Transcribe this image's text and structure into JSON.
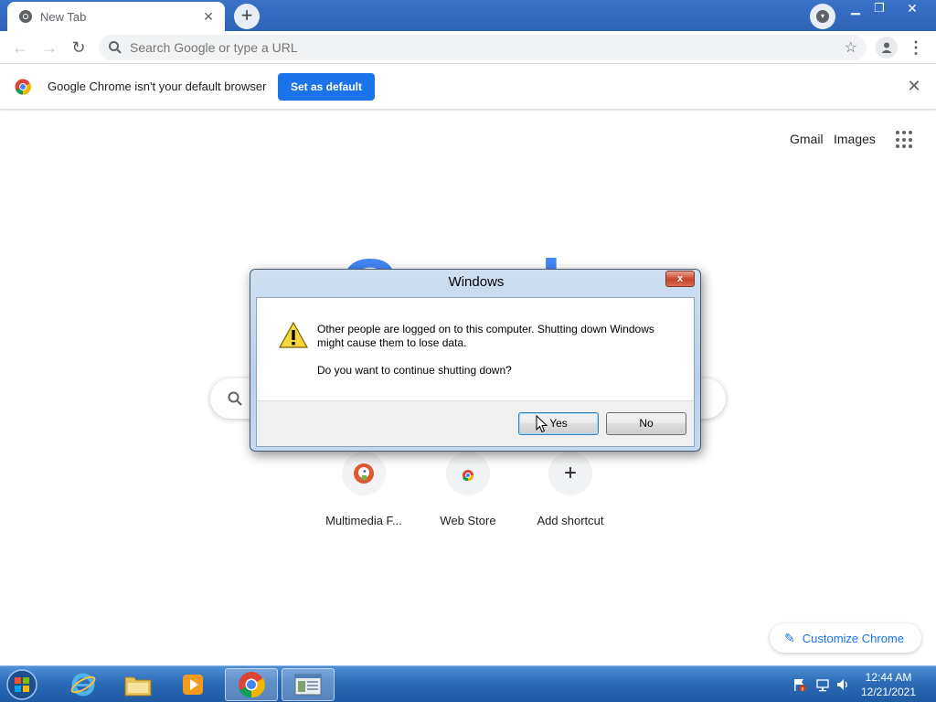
{
  "browser": {
    "tab_title": "New Tab",
    "tab_close": "✕",
    "new_tab": "+",
    "omnibox_placeholder": "Search Google or type a URL"
  },
  "infobar": {
    "message": "Google Chrome isn't your default browser",
    "button": "Set as default",
    "close": "✕"
  },
  "ntp": {
    "links": [
      "Gmail",
      "Images"
    ],
    "logo_text": "Google",
    "shortcuts": [
      {
        "label": "Multimedia F...",
        "icon": "duckduckgo-icon"
      },
      {
        "label": "Web Store",
        "icon": "chrome-web-store-icon"
      },
      {
        "label": "Add shortcut",
        "icon": "plus-icon",
        "glyph": "+"
      }
    ],
    "customize": "Customize Chrome"
  },
  "dialog": {
    "title": "Windows",
    "message": "Other people are logged on to this computer. Shutting down Windows might cause them to lose data.",
    "question": "Do you want to continue shutting down?",
    "yes": "Yes",
    "no": "No",
    "close": "x"
  },
  "taskbar": {
    "time": "12:44 AM",
    "date": "12/21/2021",
    "items": [
      "internet-explorer-icon",
      "file-explorer-icon",
      "media-player-icon",
      "chrome-icon",
      "window-app-icon"
    ]
  },
  "colors": {
    "accent_blue": "#1a73e8",
    "taskbar_blue": "#2c6bb8",
    "tabstrip_blue": "#3a72c8"
  }
}
